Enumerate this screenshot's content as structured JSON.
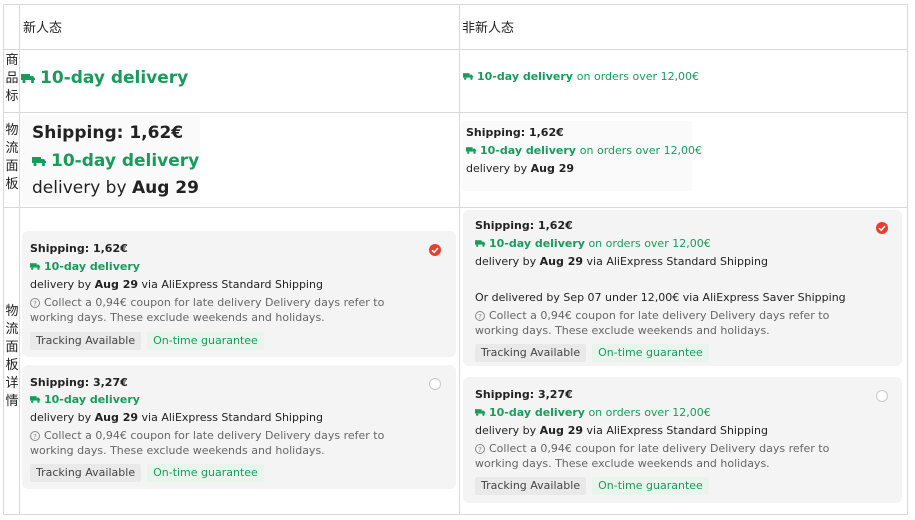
{
  "header": {
    "col_new": "新人态",
    "col_old": "非新人态"
  },
  "row_labels": {
    "product": [
      "商",
      "品",
      "标"
    ],
    "panel": [
      "物",
      "流",
      "面",
      "板"
    ],
    "details": [
      "物",
      "流",
      "面",
      "板",
      "详",
      "情"
    ]
  },
  "product_row": {
    "new_badge": "10-day delivery",
    "old_badge": "10-day delivery",
    "old_suffix": "on orders over 12,00€"
  },
  "panel_row": {
    "new": {
      "shipping": "Shipping: 1,62€",
      "badge": "10-day delivery",
      "delivery_prefix": "delivery by",
      "delivery_date": "Aug 29"
    },
    "old": {
      "shipping": "Shipping: 1,62€",
      "badge": "10-day delivery",
      "badge_suffix": "on orders over 12,00€",
      "delivery_prefix": "delivery by",
      "delivery_date": "Aug 29"
    }
  },
  "details_row": {
    "new_cards": [
      {
        "shipping": "Shipping: 1,62€",
        "badge": "10-day delivery",
        "delivery_prefix": "delivery by",
        "delivery_date": "Aug 29",
        "delivery_suffix": "via AliExpress Standard Shipping",
        "note": "Collect a 0,94€ coupon for late delivery Delivery days refer to working days. These exclude weekends and holidays.",
        "chip1": "Tracking Available",
        "chip2": "On-time guarantee",
        "selected": true
      },
      {
        "shipping": "Shipping: 3,27€",
        "badge": "10-day delivery",
        "delivery_prefix": "delivery by",
        "delivery_date": "Aug 29",
        "delivery_suffix": "via AliExpress Standard Shipping",
        "note": "Collect a 0,94€ coupon for late delivery Delivery days refer to working days. These exclude weekends and holidays.",
        "chip1": "Tracking Available",
        "chip2": "On-time guarantee",
        "selected": false
      }
    ],
    "old_cards": [
      {
        "shipping": "Shipping: 1,62€",
        "badge": "10-day delivery",
        "badge_suffix": "on orders over 12,00€",
        "delivery_prefix": "delivery by",
        "delivery_date": "Aug 29",
        "delivery_suffix": "via AliExpress Standard Shipping",
        "alt": "Or delivered by Sep 07 under 12,00€ via AliExpress Saver Shipping",
        "note": "Collect a 0,94€ coupon for late delivery Delivery days refer to working days. These exclude weekends and holidays.",
        "chip1": "Tracking Available",
        "chip2": "On-time guarantee",
        "selected": true
      },
      {
        "shipping": "Shipping: 3,27€",
        "badge": "10-day delivery",
        "badge_suffix": "on orders over 12,00€",
        "delivery_prefix": "delivery by",
        "delivery_date": "Aug 29",
        "delivery_suffix": "via AliExpress Standard Shipping",
        "note": "Collect a 0,94€ coupon for late delivery Delivery days refer to working days. These exclude weekends and holidays.",
        "chip1": "Tracking Available",
        "chip2": "On-time guarantee",
        "selected": false
      }
    ]
  },
  "colors": {
    "green": "#1a9b5c",
    "radio_selected": "#ea3d2f",
    "card_bg": "#f4f4f4"
  }
}
